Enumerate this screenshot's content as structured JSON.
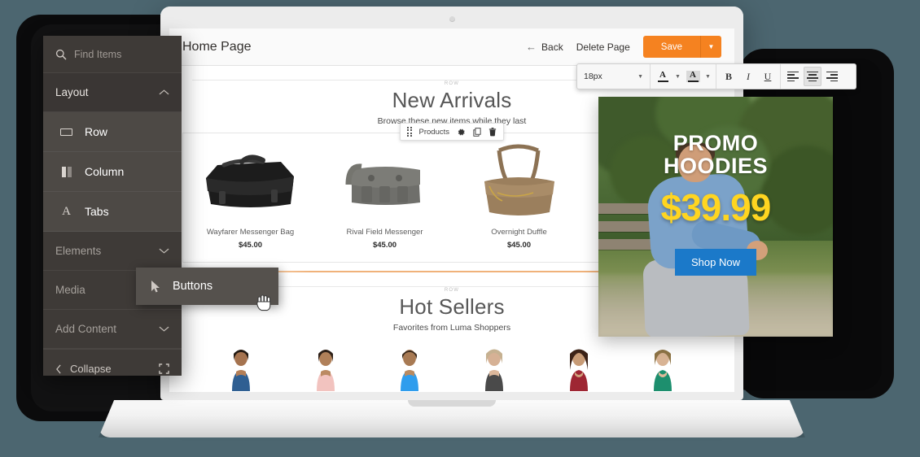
{
  "theme": {
    "background": "#4c6670",
    "sidebar_bg": "#3e3a37",
    "sidebar_item_bg": "#4d4945",
    "accent_orange": "#f58220",
    "promo_price_yellow": "#ffd520",
    "shop_button_blue": "#1b79c9"
  },
  "editor_header": {
    "page_title": "Home Page",
    "back_label": "Back",
    "back_icon": "arrow-left-icon",
    "delete_label": "Delete Page",
    "save_label": "Save",
    "save_caret_icon": "chevron-down-icon"
  },
  "format_toolbar": {
    "font_size": "18px",
    "font_size_caret": "chevron-down-icon",
    "text_color_icon": "text-color-A-icon",
    "text_color_caret": "chevron-down-icon",
    "highlight_color_icon": "highlight-color-A-icon",
    "highlight_color_caret": "chevron-down-icon",
    "bold": "B",
    "italic": "I",
    "underline": "U",
    "align_left_icon": "align-left-icon",
    "align_center_icon": "align-center-icon",
    "align_right_icon": "align-right-icon",
    "active_align": "center"
  },
  "canvas": {
    "row_tag": "ROW",
    "sections": [
      {
        "title": "New Arrivals",
        "subtitle": "Browse these new items while they last",
        "element_toolbar": {
          "drag_icon": "drag-handle-icon",
          "label": "Products",
          "settings_icon": "gear-icon",
          "duplicate_icon": "copy-icon",
          "delete_icon": "trash-icon"
        },
        "products": [
          {
            "name": "Wayfarer Messenger Bag",
            "price": "$45.00",
            "image": "black-messenger-bag"
          },
          {
            "name": "Rival Field Messenger",
            "price": "$45.00",
            "image": "gray-messenger-bag"
          },
          {
            "name": "Overnight Duffle",
            "price": "$45.00",
            "image": "brown-duffle-bag"
          },
          {
            "name": "",
            "price": "",
            "image": "partial-bag"
          }
        ]
      },
      {
        "title": "Hot Sellers",
        "subtitle": "Favorites from Luma Shoppers",
        "models": [
          {
            "top_color": "#2f5f92"
          },
          {
            "top_color": "#f2c3bf"
          },
          {
            "top_color": "#2f9ded"
          },
          {
            "top_color": "#4a4a4a"
          },
          {
            "top_color": "#9e2633"
          },
          {
            "top_color": "#1d8f6e"
          }
        ]
      }
    ]
  },
  "promo": {
    "line1": "PROMO",
    "line2": "HOODIES",
    "price": "$39.99",
    "button_label": "Shop Now"
  },
  "sidebar": {
    "search_placeholder": "Find Items",
    "search_icon": "search-icon",
    "groups": [
      {
        "label": "Layout",
        "state": "expanded",
        "caret": "chevron-up-icon"
      },
      {
        "label": "Elements",
        "state": "collapsed",
        "caret": "chevron-down-icon"
      },
      {
        "label": "Media",
        "state": "collapsed",
        "caret": ""
      },
      {
        "label": "Add Content",
        "state": "collapsed",
        "caret": "chevron-down-icon"
      }
    ],
    "layout_items": [
      {
        "label": "Row",
        "icon": "row-icon"
      },
      {
        "label": "Column",
        "icon": "column-icon"
      },
      {
        "label": "Tabs",
        "icon": "text-A-icon"
      }
    ],
    "collapse": {
      "label": "Collapse",
      "icon": "chevron-left-icon",
      "expand_icon": "fullscreen-icon"
    },
    "flyout": {
      "label": "Buttons",
      "icon": "pointer-arrow-icon"
    },
    "cursor": "grab-hand-cursor"
  }
}
